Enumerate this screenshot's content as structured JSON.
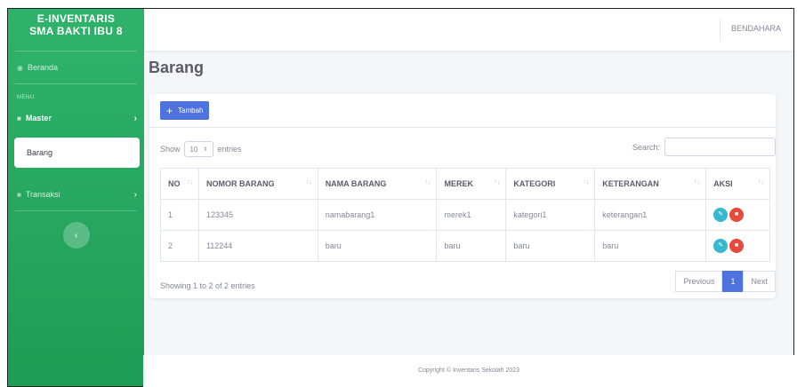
{
  "sidebar": {
    "brand_line1": "E-INVENTARIS",
    "brand_line2": "SMA BAKTI IBU 8",
    "beranda": "Beranda",
    "menu_label": "MENU",
    "master": "Master",
    "barang": "Barang",
    "transaksi": "Transaksi"
  },
  "topbar": {
    "user": "BENDAHARA"
  },
  "page": {
    "title": "Barang"
  },
  "card": {
    "add_button": "Tambah",
    "show_prefix": "Show",
    "show_value": "10",
    "show_suffix": "entries",
    "search_label": "Search:",
    "headers": [
      "NO",
      "NOMOR BARANG",
      "NAMA BARANG",
      "MEREK",
      "KATEGORI",
      "KETERANGAN",
      "AKSI"
    ],
    "rows": [
      [
        "1",
        "123345",
        "namabarang1",
        "merek1",
        "kategori1",
        "keterangan1"
      ],
      [
        "2",
        "112244",
        "baru",
        "baru",
        "baru",
        "baru"
      ]
    ],
    "info": "Showing 1 to 2 of 2 entries",
    "prev": "Previous",
    "page": "1",
    "next": "Next"
  },
  "footer": {
    "text": "Copyright © Inventaris Sekolah 2023"
  },
  "colors": {
    "sidebar": "#2fb36b",
    "primary": "#4e73df",
    "info": "#36b9cc",
    "danger": "#e74a3b"
  }
}
